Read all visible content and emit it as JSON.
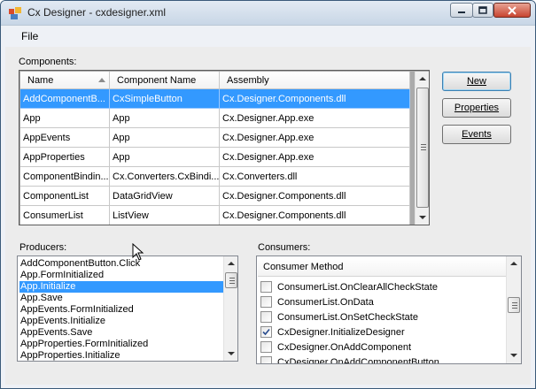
{
  "window": {
    "title": "Cx Designer - cxdesigner.xml",
    "controls": {
      "minimize": "minimize",
      "maximize": "maximize",
      "close": "close"
    }
  },
  "menu": {
    "file": "File"
  },
  "components": {
    "label": "Components:",
    "columns": [
      "Name",
      "Component Name",
      "Assembly"
    ],
    "rows": [
      {
        "name": "AddComponentB...",
        "component": "CxSimpleButton",
        "assembly": "Cx.Designer.Components.dll",
        "selected": true
      },
      {
        "name": "App",
        "component": "App",
        "assembly": "Cx.Designer.App.exe"
      },
      {
        "name": "AppEvents",
        "component": "App",
        "assembly": "Cx.Designer.App.exe"
      },
      {
        "name": "AppProperties",
        "component": "App",
        "assembly": "Cx.Designer.App.exe"
      },
      {
        "name": "ComponentBindin...",
        "component": "Cx.Converters.CxBindi...",
        "assembly": "Cx.Converters.dll"
      },
      {
        "name": "ComponentList",
        "component": "DataGridView",
        "assembly": "Cx.Designer.Components.dll"
      },
      {
        "name": "ConsumerList",
        "component": "ListView",
        "assembly": "Cx.Designer.Components.dll"
      }
    ]
  },
  "buttons": {
    "new": "New",
    "properties": "Properties",
    "events": "Events"
  },
  "producers": {
    "label": "Producers:",
    "items": [
      "AddComponentButton.Click",
      "App.FormInitialized",
      "App.Initialize",
      "App.Save",
      "AppEvents.FormInitialized",
      "AppEvents.Initialize",
      "AppEvents.Save",
      "AppProperties.FormInitialized",
      "AppProperties.Initialize"
    ],
    "selected_index": 2
  },
  "consumers": {
    "label": "Consumers:",
    "header": "Consumer Method",
    "items": [
      {
        "label": "ConsumerList.OnClearAllCheckState",
        "checked": false
      },
      {
        "label": "ConsumerList.OnData",
        "checked": false
      },
      {
        "label": "ConsumerList.OnSetCheckState",
        "checked": false
      },
      {
        "label": "CxDesigner.InitializeDesigner",
        "checked": true
      },
      {
        "label": "CxDesigner.OnAddComponent",
        "checked": false
      },
      {
        "label": "CxDesigner.OnAddComponentButton",
        "checked": false
      }
    ]
  },
  "colors": {
    "selection": "#3399ff",
    "window_border": "#3a5a7a",
    "close_button": "#c8442f"
  }
}
